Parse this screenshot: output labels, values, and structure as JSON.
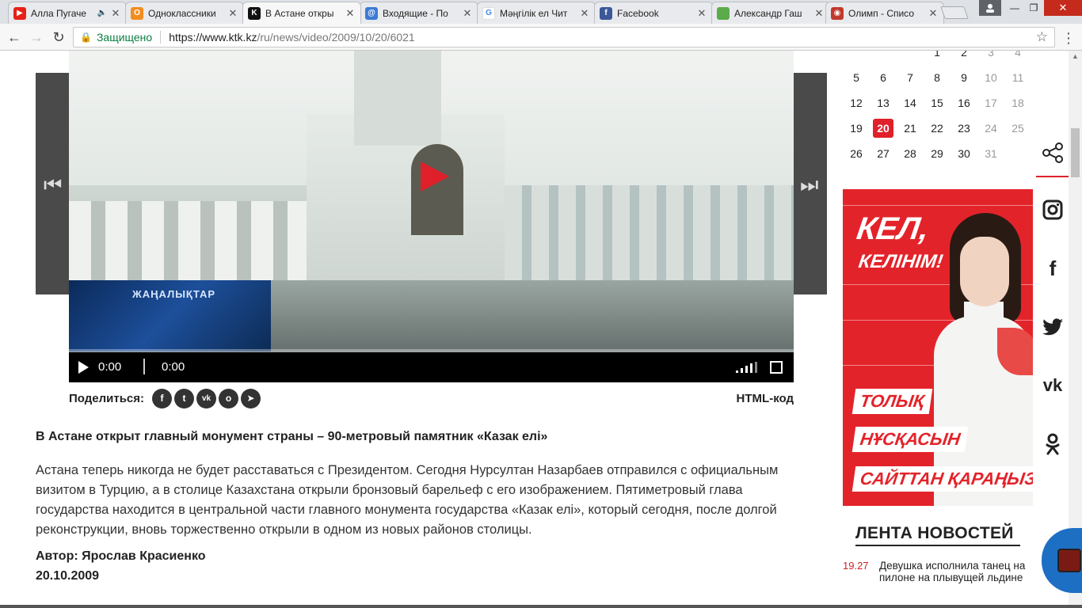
{
  "browser": {
    "tabs": [
      {
        "title": "Алла Пугаче",
        "favicon": "youtube-icon",
        "color": "#e62117",
        "active": false,
        "muted": true
      },
      {
        "title": "Одноклассники",
        "favicon": "ok-icon",
        "color": "#f28d1f",
        "active": false
      },
      {
        "title": "В Астане откры",
        "favicon": "ktk-icon",
        "color": "#111111",
        "active": true
      },
      {
        "title": "Входящие - По",
        "favicon": "mail-icon",
        "color": "#3a7bd5",
        "active": false
      },
      {
        "title": "Мәңгілік ел Чит",
        "favicon": "google-icon",
        "color": "#4285f4",
        "active": false
      },
      {
        "title": "Facebook",
        "favicon": "facebook-icon",
        "color": "#3b5998",
        "active": false
      },
      {
        "title": "Александр Гаш",
        "favicon": "sheet-icon",
        "color": "#5cab4a",
        "active": false
      },
      {
        "title": "Олимп - Списо",
        "favicon": "olimp-icon",
        "color": "#c0392b",
        "active": false
      }
    ],
    "secure_label": "Защищено",
    "url_main": "https://www.ktk.kz",
    "url_path": "/ru/news/video/2009/10/20/6021"
  },
  "video": {
    "logo_text": "ЖАҢАЛЫҚТАР",
    "time_current": "0:00",
    "time_total": "0:00"
  },
  "share": {
    "label": "Поделиться:",
    "icons": [
      "facebook-icon",
      "twitter-icon",
      "vk-icon",
      "ok-icon",
      "telegram-icon"
    ],
    "html_code": "HTML-код"
  },
  "article": {
    "headline": "В Астане открыт главный монумент страны – 90-метровый памятник «Казак елі»",
    "body": "Астана теперь никогда не будет расставаться с Президентом. Сегодня Нурсултан Назарбаев отправился с официальным визитом в Турцию, а в столице Казахстана открыли бронзовый барельеф с его изображением. Пятиметровый глава государства находится в центральной части главного монумента государства «Казак елі», который сегодня, после долгой реконструкции, вновь торжественно открыли в одном из новых районов столицы.",
    "author": "Автор: Ярослав Красиенко",
    "date": "20.10.2009"
  },
  "calendar": {
    "weeks": [
      [
        "",
        "",
        "",
        "1",
        "2",
        "3",
        "4"
      ],
      [
        "5",
        "6",
        "7",
        "8",
        "9",
        "10",
        "11"
      ],
      [
        "12",
        "13",
        "14",
        "15",
        "16",
        "17",
        "18"
      ],
      [
        "19",
        "20",
        "21",
        "22",
        "23",
        "24",
        "25"
      ],
      [
        "26",
        "27",
        "28",
        "29",
        "30",
        "31",
        ""
      ]
    ],
    "today": "20"
  },
  "ad": {
    "title": "КЕЛ,",
    "subtitle": "КЕЛІНІМ!",
    "line1": "ТОЛЫҚ",
    "line2": "НҰСҚАСЫН",
    "line3": "САЙТТАН ҚАРАҢЫЗ!"
  },
  "news": {
    "title": "ЛЕНТА НОВОСТЕЙ",
    "items": [
      {
        "time": "19.27",
        "text": "Девушка исполнила танец на пилоне на плывущей льдине"
      }
    ]
  },
  "social_sidebar": [
    "share-icon",
    "instagram-icon",
    "facebook-icon",
    "twitter-icon",
    "vk-icon",
    "ok-icon"
  ]
}
